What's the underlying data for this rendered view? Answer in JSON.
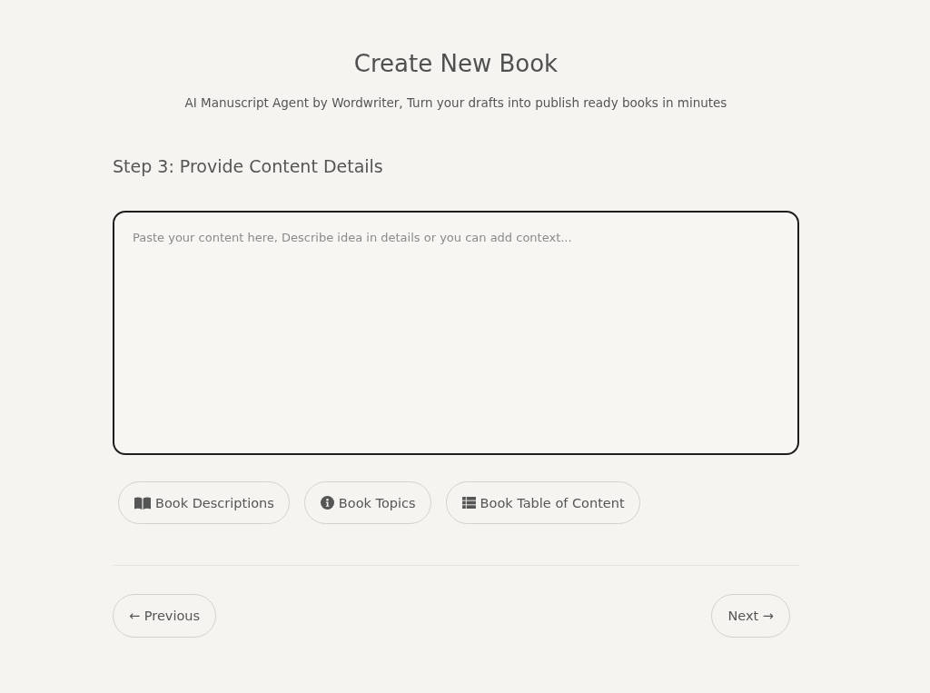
{
  "header": {
    "title": "Create New Book",
    "subtitle": "AI Manuscript Agent by Wordwriter, Turn your drafts into publish ready books in minutes"
  },
  "step": {
    "heading": "Step 3: Provide Content Details"
  },
  "content_field": {
    "placeholder": "Paste your content here, Describe idea in details or you can add context..."
  },
  "suggestions": [
    {
      "kind": "book",
      "label": "Book Descriptions"
    },
    {
      "kind": "info",
      "label": "Book Topics"
    },
    {
      "kind": "list",
      "label": "Book Table of Content"
    }
  ],
  "navigation": {
    "previous": "← Previous",
    "next": "Next →"
  }
}
